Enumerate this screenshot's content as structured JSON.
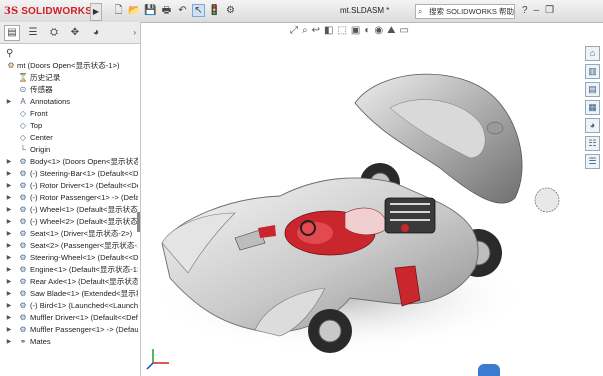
{
  "app": {
    "logo_ds": "3S",
    "logo_name": "SOLIDWORKS"
  },
  "document_title": "mt.SLDASM *",
  "search": {
    "label": "搜索 SOLIDWORKS 帮助"
  },
  "toolbar": {
    "icons": [
      "new-icon",
      "open-icon",
      "save-icon",
      "print-icon",
      "undo-icon",
      "select-icon",
      "rebuild-icon",
      "options-icon"
    ]
  },
  "tree": {
    "root": "mt  (Doors Open<显示状态-1>)",
    "items": [
      {
        "label": "历史记录"
      },
      {
        "label": "传感器"
      },
      {
        "label": "Annotations"
      },
      {
        "label": "Front"
      },
      {
        "label": "Top"
      },
      {
        "label": "Center"
      },
      {
        "label": "Origin"
      },
      {
        "label": "Body<1> (Doors Open<显示状态-"
      },
      {
        "label": "(-) Steering-Bar<1> (Default<<De"
      },
      {
        "label": "(-) Rotor Driver<1> (Default<<Def"
      },
      {
        "label": "(-) Rotor Passenger<1> -> (Defau"
      },
      {
        "label": "(-) Wheel<1> (Default<显示状态-1"
      },
      {
        "label": "(-) Wheel<2> (Default<显示状态-1"
      },
      {
        "label": "Seat<1> (Driver<显示状态-2>)"
      },
      {
        "label": "Seat<2> (Passenger<显示状态-1>"
      },
      {
        "label": "Steering-Wheel<1> (Default<<De"
      },
      {
        "label": "Engine<1> (Default<显示状态-1>"
      },
      {
        "label": "Rear Axle<1> (Default<显示状态-1"
      },
      {
        "label": "Saw Blade<1> (Extended<显示状"
      },
      {
        "label": "(-) Bird<1> (Launched<<Launche"
      },
      {
        "label": "Muffler Driver<1> (Default<<Def"
      },
      {
        "label": "Muffler Passenger<1> -> (Defaul"
      },
      {
        "label": "Mates"
      }
    ]
  }
}
